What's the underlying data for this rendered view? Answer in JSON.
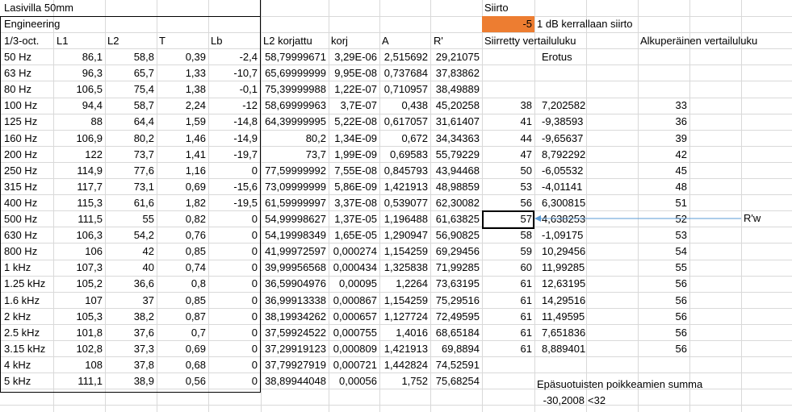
{
  "sheet": {
    "title": "Lasivilla 50mm",
    "engineering_label": "Engineering",
    "siirto_label": "Siirto",
    "siirto_value": "-5",
    "siirto_desc": "1 dB kerrallaan siirto",
    "headers": [
      "1/3-oct.",
      "L1",
      "L2",
      "T",
      "Lb",
      "L2 korjattu",
      "korj",
      "A",
      "R'",
      "Siirretty vertailuluku",
      "Alkuperäinen vertailuluku"
    ],
    "erotus_label": "Erotus",
    "rows": [
      {
        "f": "50 Hz",
        "l1": "86,1",
        "l2": "58,8",
        "t": "0,39",
        "lb": "-2,4",
        "l2k": "58,79999671",
        "korj": "3,29E-06",
        "a": "2,515692",
        "r": "29,21075",
        "s": "",
        "e": "",
        "o": ""
      },
      {
        "f": "63 Hz",
        "l1": "96,3",
        "l2": "65,7",
        "t": "1,33",
        "lb": "-10,7",
        "l2k": "65,69999999",
        "korj": "9,95E-08",
        "a": "0,737684",
        "r": "37,83862",
        "s": "",
        "e": "",
        "o": ""
      },
      {
        "f": "80 Hz",
        "l1": "106,5",
        "l2": "75,4",
        "t": "1,38",
        "lb": "-0,1",
        "l2k": "75,39999988",
        "korj": "1,22E-07",
        "a": "0,710957",
        "r": "38,49889",
        "s": "",
        "e": "",
        "o": ""
      },
      {
        "f": "100 Hz",
        "l1": "94,4",
        "l2": "58,7",
        "t": "2,24",
        "lb": "-12",
        "l2k": "58,69999963",
        "korj": "3,7E-07",
        "a": "0,438",
        "r": "45,20258",
        "s": "38",
        "e": "7,202582",
        "o": "33"
      },
      {
        "f": "125 Hz",
        "l1": "88",
        "l2": "64,4",
        "t": "1,59",
        "lb": "-14,8",
        "l2k": "64,39999995",
        "korj": "5,22E-08",
        "a": "0,617057",
        "r": "31,61407",
        "s": "41",
        "e": "-9,38593",
        "o": "36"
      },
      {
        "f": "160 Hz",
        "l1": "106,9",
        "l2": "80,2",
        "t": "1,46",
        "lb": "-14,9",
        "l2k": "80,2",
        "korj": "1,34E-09",
        "a": "0,672",
        "r": "34,34363",
        "s": "44",
        "e": "-9,65637",
        "o": "39"
      },
      {
        "f": "200 Hz",
        "l1": "122",
        "l2": "73,7",
        "t": "1,41",
        "lb": "-19,7",
        "l2k": "73,7",
        "korj": "1,99E-09",
        "a": "0,69583",
        "r": "55,79229",
        "s": "47",
        "e": "8,792292",
        "o": "42"
      },
      {
        "f": "250 Hz",
        "l1": "114,9",
        "l2": "77,6",
        "t": "1,16",
        "lb": "0",
        "l2k": "77,59999992",
        "korj": "7,55E-08",
        "a": "0,845793",
        "r": "43,94468",
        "s": "50",
        "e": "-6,05532",
        "o": "45"
      },
      {
        "f": "315 Hz",
        "l1": "117,7",
        "l2": "73,1",
        "t": "0,69",
        "lb": "-15,6",
        "l2k": "73,09999999",
        "korj": "5,86E-09",
        "a": "1,421913",
        "r": "48,98859",
        "s": "53",
        "e": "-4,01141",
        "o": "48"
      },
      {
        "f": "400 Hz",
        "l1": "115,3",
        "l2": "61,6",
        "t": "1,82",
        "lb": "-19,5",
        "l2k": "61,59999997",
        "korj": "3,37E-08",
        "a": "0,539077",
        "r": "62,30082",
        "s": "56",
        "e": "6,300815",
        "o": "51"
      },
      {
        "f": "500 Hz",
        "l1": "111,5",
        "l2": "55",
        "t": "0,82",
        "lb": "0",
        "l2k": "54,99998627",
        "korj": "1,37E-05",
        "a": "1,196488",
        "r": "61,63825",
        "s": "57",
        "e": "4,638253",
        "o": "52"
      },
      {
        "f": "630 Hz",
        "l1": "106,3",
        "l2": "54,2",
        "t": "0,76",
        "lb": "0",
        "l2k": "54,19998349",
        "korj": "1,65E-05",
        "a": "1,290947",
        "r": "56,90825",
        "s": "58",
        "e": "-1,09175",
        "o": "53"
      },
      {
        "f": "800 Hz",
        "l1": "106",
        "l2": "42",
        "t": "0,85",
        "lb": "0",
        "l2k": "41,99972597",
        "korj": "0,000274",
        "a": "1,154259",
        "r": "69,29456",
        "s": "59",
        "e": "10,29456",
        "o": "54"
      },
      {
        "f": "1 kHz",
        "l1": "107,3",
        "l2": "40",
        "t": "0,74",
        "lb": "0",
        "l2k": "39,99956568",
        "korj": "0,000434",
        "a": "1,325838",
        "r": "71,99285",
        "s": "60",
        "e": "11,99285",
        "o": "55"
      },
      {
        "f": "1.25 kHz",
        "l1": "105,2",
        "l2": "36,6",
        "t": "0,8",
        "lb": "0",
        "l2k": "36,59904976",
        "korj": "0,00095",
        "a": "1,2264",
        "r": "73,63195",
        "s": "61",
        "e": "12,63195",
        "o": "56"
      },
      {
        "f": "1.6 kHz",
        "l1": "107",
        "l2": "37",
        "t": "0,85",
        "lb": "0",
        "l2k": "36,99913338",
        "korj": "0,000867",
        "a": "1,154259",
        "r": "75,29516",
        "s": "61",
        "e": "14,29516",
        "o": "56"
      },
      {
        "f": "2 kHz",
        "l1": "105,3",
        "l2": "38,2",
        "t": "0,87",
        "lb": "0",
        "l2k": "38,19934262",
        "korj": "0,000657",
        "a": "1,127724",
        "r": "72,49595",
        "s": "61",
        "e": "11,49595",
        "o": "56"
      },
      {
        "f": "2.5 kHz",
        "l1": "101,8",
        "l2": "37,6",
        "t": "0,7",
        "lb": "0",
        "l2k": "37,59924522",
        "korj": "0,000755",
        "a": "1,4016",
        "r": "68,65184",
        "s": "61",
        "e": "7,651836",
        "o": "56"
      },
      {
        "f": "3.15 kHz",
        "l1": "102,8",
        "l2": "37,3",
        "t": "0,69",
        "lb": "0",
        "l2k": "37,29919123",
        "korj": "0,000809",
        "a": "1,421913",
        "r": "69,8894",
        "s": "61",
        "e": "8,889401",
        "o": "56"
      },
      {
        "f": "4 kHz",
        "l1": "108",
        "l2": "37,8",
        "t": "0,68",
        "lb": "0",
        "l2k": "37,79927919",
        "korj": "0,000721",
        "a": "1,442824",
        "r": "74,52591",
        "s": "",
        "e": "",
        "o": ""
      },
      {
        "f": "5 kHz",
        "l1": "111,1",
        "l2": "38,9",
        "t": "0,56",
        "lb": "0",
        "l2k": "38,89944048",
        "korj": "0,00056",
        "a": "1,752",
        "r": "75,68254",
        "s": "",
        "e": "",
        "o": ""
      }
    ],
    "rw_label": "R'w",
    "sum_label": "Epäsuotuisten poikkeamien summa",
    "sum_value": "-30,2008",
    "sum_limit": "<32",
    "colors": {
      "highlight": "#ed7d31",
      "arrow": "#5b9bd5",
      "gridline": "#d9d9d9"
    }
  }
}
